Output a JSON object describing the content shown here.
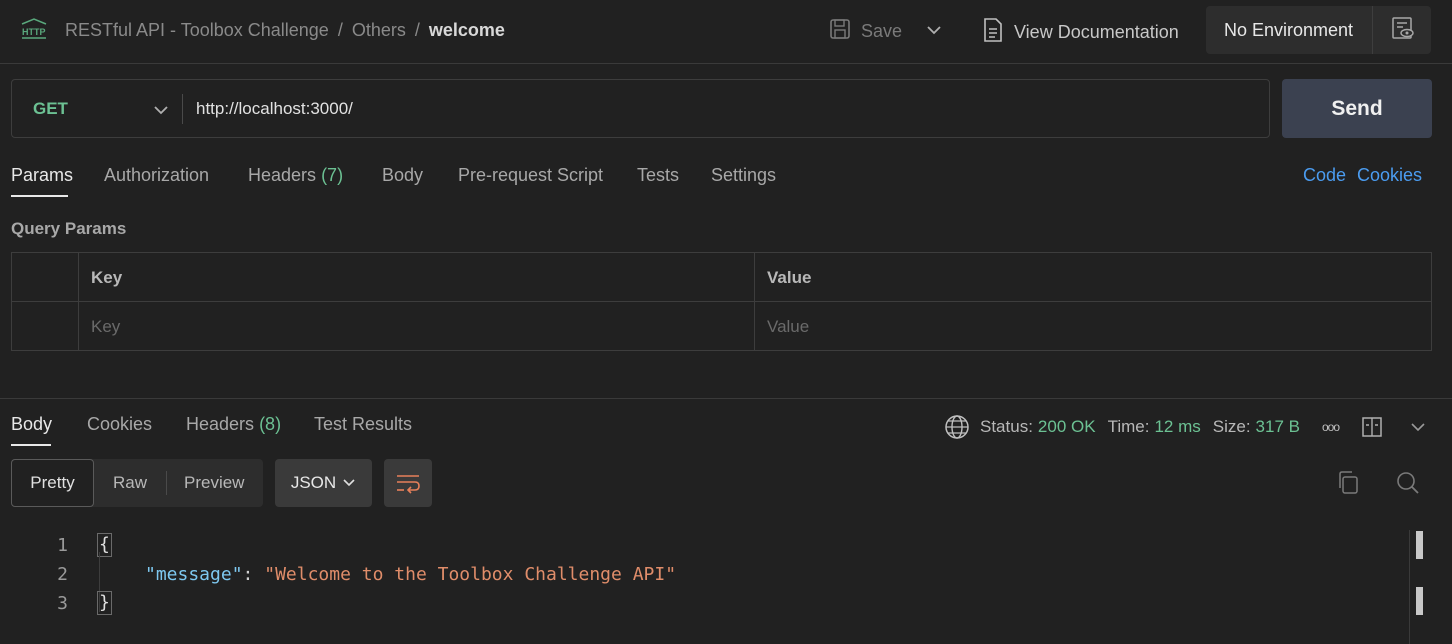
{
  "header": {
    "breadcrumb": [
      "RESTful API - Toolbox Challenge",
      "Others",
      "welcome"
    ],
    "breadcrumb_sep": "/",
    "save_label": "Save",
    "view_doc_label": "View Documentation",
    "environment": "No Environment",
    "http_icon_text": "HTTP"
  },
  "request": {
    "method": "GET",
    "url": "http://localhost:3000/",
    "send_label": "Send"
  },
  "request_tabs": {
    "params": "Params",
    "authorization": "Authorization",
    "headers": "Headers",
    "headers_count": "(7)",
    "body": "Body",
    "prerequest": "Pre-request Script",
    "tests": "Tests",
    "settings": "Settings",
    "code": "Code",
    "cookies": "Cookies"
  },
  "query_params": {
    "title": "Query Params",
    "key_header": "Key",
    "value_header": "Value",
    "key_placeholder": "Key",
    "value_placeholder": "Value"
  },
  "response_tabs": {
    "body": "Body",
    "cookies": "Cookies",
    "headers": "Headers",
    "headers_count": "(8)",
    "test_results": "Test Results"
  },
  "response_status": {
    "status_label": "Status:",
    "status_value": "200 OK",
    "time_label": "Time:",
    "time_value": "12 ms",
    "size_label": "Size:",
    "size_value": "317 B",
    "more": "ooo"
  },
  "view_modes": {
    "pretty": "Pretty",
    "raw": "Raw",
    "preview": "Preview",
    "format": "JSON"
  },
  "response_body": {
    "line_numbers": [
      "1",
      "2",
      "3"
    ],
    "open_brace": "{",
    "key": "\"message\"",
    "colon": ": ",
    "value": "\"Welcome to the Toolbox Challenge API\"",
    "close_brace": "}"
  },
  "colors": {
    "background": "#212121",
    "accent_green": "#6cc193",
    "link_blue": "#4b9cf0",
    "send_bg": "#3b4150",
    "json_key": "#7ec8f0",
    "json_string": "#e08d6a"
  },
  "icons": [
    "http-icon",
    "save-icon",
    "chevron-down-icon",
    "document-icon",
    "environment-eye-icon",
    "globe-icon",
    "more-icon",
    "split-layout-icon",
    "wrap-lines-icon",
    "copy-icon",
    "search-icon"
  ]
}
